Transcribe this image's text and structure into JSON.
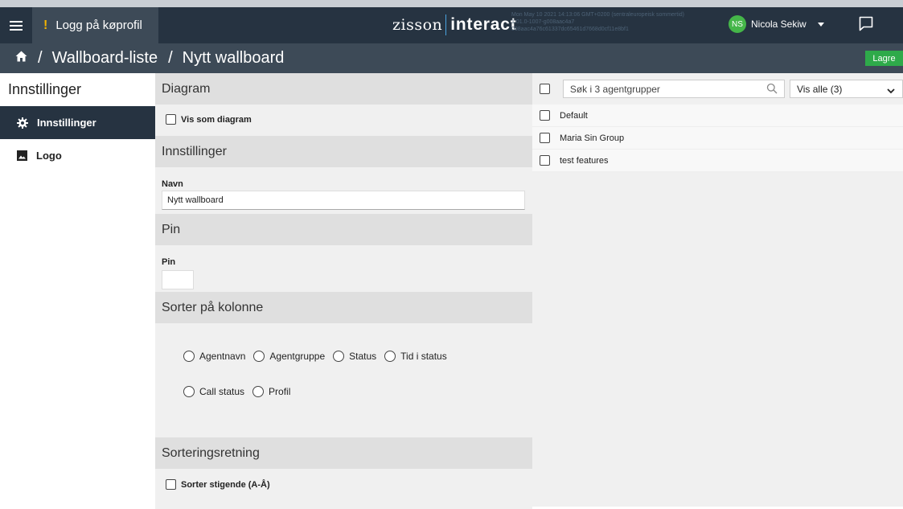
{
  "topbar": {
    "login_label": "Logg på køprofil",
    "login_alert": "!",
    "logo_left": "zisson",
    "logo_right": "interact",
    "meta_lines": [
      "Mon May 10 2021 14:13:06 GMT+0200 (sentraleuropeisk sommertid)",
      "1.01.0-1007-g008aac4a7",
      "008aac4a76c61337dc65461d7668d0cf11e8bf1"
    ],
    "user_initials": "NS",
    "user_name": "Nicola Sekiw",
    "icons": {
      "menu": "hamburger-icon",
      "chat": "chat-icon",
      "user_menu": "caret-down-icon"
    },
    "avatar_color": "#45b649"
  },
  "breadcrumb": {
    "home_icon": "home-icon",
    "items": [
      "Wallboard-liste",
      "Nytt wallboard"
    ],
    "separator": "/",
    "save_label": "Lagre",
    "save_color": "#2eaa4a"
  },
  "sidebar": {
    "title": "Innstillinger",
    "items": [
      {
        "label": "Innstillinger",
        "icon": "gear-icon",
        "active": true
      },
      {
        "label": "Logo",
        "icon": "image-icon",
        "active": false
      }
    ]
  },
  "settings": {
    "diagram": {
      "heading": "Diagram",
      "checkbox_label": "Vis som diagram",
      "checked": false
    },
    "innstillinger": {
      "heading": "Innstillinger",
      "name_label": "Navn",
      "name_value": "Nytt wallboard"
    },
    "pin": {
      "heading": "Pin",
      "label": "Pin",
      "value": ""
    },
    "sort_column": {
      "heading": "Sorter på kolonne",
      "options": [
        "Agentnavn",
        "Agentgruppe",
        "Status",
        "Tid i status",
        "Call status",
        "Profil"
      ],
      "selected": null
    },
    "sort_direction": {
      "heading": "Sorteringsretning",
      "checkbox_label": "Sorter stigende (A-Å)",
      "checked": false
    }
  },
  "groups": {
    "search_placeholder": "Søk i 3 agentgrupper",
    "filter_value": "Vis alle (3)",
    "items": [
      "Default",
      "Maria Sin Group",
      "test features"
    ]
  }
}
